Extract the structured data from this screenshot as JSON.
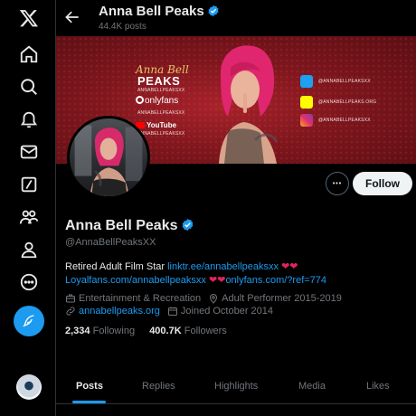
{
  "nav": {
    "items": [
      {
        "icon": "x-logo-icon"
      },
      {
        "icon": "home-icon"
      },
      {
        "icon": "search-icon"
      },
      {
        "icon": "notifications-bell-icon"
      },
      {
        "icon": "messages-envelope-icon"
      },
      {
        "icon": "grok-icon"
      },
      {
        "icon": "communities-icon"
      },
      {
        "icon": "profile-person-icon"
      },
      {
        "icon": "more-circle-icon"
      }
    ],
    "compose_icon": "feather-compose-icon",
    "accent": "#1d9bf0"
  },
  "header": {
    "name": "Anna Bell Peaks",
    "post_count": "44.4K posts"
  },
  "banner": {
    "script_text": "Anna Bell",
    "peaks_text": "PEAKS",
    "handle_1": "ANNABELLPEAKSXX",
    "onlyfans_text": "onlyfans",
    "handle_2": "ANNABELLPEAKSXX",
    "youtube_text": "YouTube",
    "handle_3": "ANNABELLPEAKSXX",
    "social_1": "@ANNABELLPEAKSXX",
    "social_2": "@ANNABELLPEAKS.ORG",
    "social_3": "@ANNABELLPEAKSXX"
  },
  "profile": {
    "name": "Anna Bell Peaks",
    "handle": "@AnnaBellPeaksXX",
    "bio_text": "Retired Adult Film Star ",
    "bio_link_1": "linktr.ee/annabellpeaksxx",
    "bio_link_2": "Loyalfans.com/annabellpeaksxx",
    "bio_link_3": "onlyfans.com/?ref=774",
    "category": "Entertainment & Recreation",
    "location": "Adult Performer 2015-2019",
    "website": "annabellpeaks.org",
    "joined": "Joined October 2014",
    "following_count": "2,334",
    "following_label": "Following",
    "followers_count": "400.7K",
    "followers_label": "Followers",
    "verified_color": "#1d9bf0"
  },
  "actions": {
    "follow_label": "Follow",
    "more_label": "•••"
  },
  "tabs": [
    "Posts",
    "Replies",
    "Highlights",
    "Media",
    "Likes"
  ],
  "active_tab": "Posts"
}
